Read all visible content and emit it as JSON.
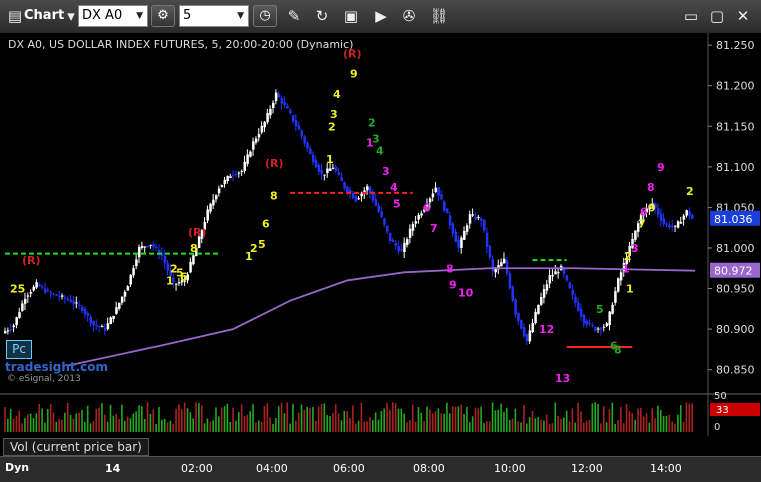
{
  "toolbar": {
    "app_label": "Chart",
    "symbol": "DX A0",
    "interval": "5",
    "icons": [
      "chart-icon",
      "gear-icon",
      "clock-icon",
      "pencil-icon",
      "refresh-icon",
      "export-icon",
      "play-icon",
      "wrench-icon",
      "link-icon"
    ]
  },
  "chart_data": {
    "type": "candlestick",
    "title": "DX A0, US DOLLAR INDEX FUTURES, 5, 20:00-20:00 (Dynamic)",
    "y_ticks": [
      "81.250",
      "81.200",
      "81.150",
      "81.100",
      "81.050",
      "81.000",
      "80.950",
      "80.900",
      "80.850"
    ],
    "ylim": [
      80.82,
      81.265
    ],
    "x_ticks": [
      "14",
      "02:00",
      "04:00",
      "06:00",
      "08:00",
      "10:00",
      "12:00",
      "14:00"
    ],
    "last_price": "81.036",
    "ma_price": "80.972",
    "price_path": [
      [
        0,
        80.895
      ],
      [
        4,
        80.905
      ],
      [
        8,
        80.94
      ],
      [
        12,
        80.955
      ],
      [
        16,
        80.945
      ],
      [
        20,
        80.94
      ],
      [
        24,
        80.935
      ],
      [
        28,
        80.925
      ],
      [
        32,
        80.905
      ],
      [
        36,
        80.9
      ],
      [
        40,
        80.925
      ],
      [
        44,
        80.955
      ],
      [
        48,
        81.0
      ],
      [
        52,
        81.005
      ],
      [
        56,
        80.99
      ],
      [
        60,
        80.955
      ],
      [
        64,
        80.96
      ],
      [
        68,
        81.0
      ],
      [
        72,
        81.045
      ],
      [
        76,
        81.075
      ],
      [
        80,
        81.09
      ],
      [
        84,
        81.095
      ],
      [
        88,
        81.13
      ],
      [
        92,
        81.155
      ],
      [
        96,
        81.19
      ],
      [
        98,
        81.18
      ],
      [
        100,
        81.17
      ],
      [
        104,
        81.145
      ],
      [
        108,
        81.115
      ],
      [
        112,
        81.09
      ],
      [
        116,
        81.1
      ],
      [
        120,
        81.075
      ],
      [
        124,
        81.06
      ],
      [
        128,
        81.075
      ],
      [
        132,
        81.045
      ],
      [
        136,
        81.01
      ],
      [
        140,
        80.995
      ],
      [
        144,
        81.03
      ],
      [
        148,
        81.05
      ],
      [
        152,
        81.075
      ],
      [
        156,
        81.04
      ],
      [
        160,
        81.0
      ],
      [
        164,
        81.04
      ],
      [
        168,
        81.035
      ],
      [
        172,
        80.97
      ],
      [
        176,
        80.985
      ],
      [
        180,
        80.92
      ],
      [
        184,
        80.885
      ],
      [
        188,
        80.93
      ],
      [
        192,
        80.965
      ],
      [
        196,
        80.975
      ],
      [
        200,
        80.94
      ],
      [
        204,
        80.91
      ],
      [
        208,
        80.9
      ],
      [
        212,
        80.905
      ],
      [
        216,
        80.96
      ],
      [
        220,
        81.0
      ],
      [
        224,
        81.04
      ],
      [
        228,
        81.055
      ],
      [
        232,
        81.03
      ],
      [
        236,
        81.025
      ],
      [
        240,
        81.045
      ],
      [
        242,
        81.036
      ]
    ],
    "moving_average": [
      [
        22,
        80.855
      ],
      [
        55,
        80.88
      ],
      [
        80,
        80.9
      ],
      [
        100,
        80.935
      ],
      [
        120,
        80.96
      ],
      [
        140,
        80.97
      ],
      [
        170,
        80.975
      ],
      [
        200,
        80.975
      ],
      [
        242,
        80.972
      ]
    ],
    "levels": [
      {
        "color": "#22dd22",
        "dash": true,
        "from": 0,
        "to": 75,
        "y": 80.993
      },
      {
        "color": "#ff2222",
        "dash": true,
        "from": 100,
        "to": 143,
        "y": 81.068
      },
      {
        "color": "#22dd22",
        "dash": true,
        "from": 185,
        "to": 197,
        "y": 80.985
      },
      {
        "color": "#ff2222",
        "dash": false,
        "from": 197,
        "to": 220,
        "y": 80.878
      }
    ],
    "annotations": [
      {
        "t": "(R)",
        "x": 22,
        "y": 80.98,
        "c": "#cc2222"
      },
      {
        "t": "(R)",
        "x": 188,
        "y": 81.015,
        "c": "#cc2222"
      },
      {
        "t": "(R)",
        "x": 265,
        "y": 81.1,
        "c": "#cc2222"
      },
      {
        "t": "(R)",
        "x": 343,
        "y": 81.235,
        "c": "#cc2222"
      },
      {
        "t": "1",
        "x": 366,
        "y": 81.125,
        "c": "#ee22ee"
      },
      {
        "t": "3",
        "x": 382,
        "y": 81.09,
        "c": "#ee22ee"
      },
      {
        "t": "4",
        "x": 390,
        "y": 81.07,
        "c": "#ee22ee"
      },
      {
        "t": "5",
        "x": 393,
        "y": 81.05,
        "c": "#ee22ee"
      },
      {
        "t": "6",
        "x": 423,
        "y": 81.045,
        "c": "#ee22ee"
      },
      {
        "t": "7",
        "x": 430,
        "y": 81.02,
        "c": "#ee22ee"
      },
      {
        "t": "8",
        "x": 446,
        "y": 80.97,
        "c": "#ee22ee"
      },
      {
        "t": "9",
        "x": 449,
        "y": 80.95,
        "c": "#ee22ee"
      },
      {
        "t": "10",
        "x": 458,
        "y": 80.94,
        "c": "#ee22ee"
      },
      {
        "t": "12",
        "x": 539,
        "y": 80.895,
        "c": "#ee22ee"
      },
      {
        "t": "13",
        "x": 555,
        "y": 80.835,
        "c": "#ee22ee"
      },
      {
        "t": "1",
        "x": 622,
        "y": 80.97,
        "c": "#ee22ee"
      },
      {
        "t": "3",
        "x": 631,
        "y": 80.995,
        "c": "#ee22ee"
      },
      {
        "t": "6",
        "x": 640,
        "y": 81.04,
        "c": "#ee22ee"
      },
      {
        "t": "8",
        "x": 647,
        "y": 81.07,
        "c": "#ee22ee"
      },
      {
        "t": "9",
        "x": 657,
        "y": 81.095,
        "c": "#ee22ee"
      },
      {
        "t": "2",
        "x": 686,
        "y": 81.065,
        "c": "#eeee22"
      },
      {
        "t": "9",
        "x": 648,
        "y": 81.045,
        "c": "#eeee22"
      },
      {
        "t": "25",
        "x": 10,
        "y": 80.945,
        "c": "#eeee22"
      },
      {
        "t": "8",
        "x": 270,
        "y": 81.06,
        "c": "#eeee22"
      },
      {
        "t": "6",
        "x": 262,
        "y": 81.025,
        "c": "#eeee22"
      },
      {
        "t": "5",
        "x": 258,
        "y": 81.0,
        "c": "#eeee22"
      },
      {
        "t": "4",
        "x": 333,
        "y": 81.185,
        "c": "#eeee22"
      },
      {
        "t": "3",
        "x": 330,
        "y": 81.16,
        "c": "#eeee22"
      },
      {
        "t": "2",
        "x": 328,
        "y": 81.145,
        "c": "#eeee22"
      },
      {
        "t": "1",
        "x": 326,
        "y": 81.105,
        "c": "#eeee22"
      },
      {
        "t": "9",
        "x": 350,
        "y": 81.21,
        "c": "#eeee22"
      },
      {
        "t": "8",
        "x": 190,
        "y": 80.995,
        "c": "#eeee22"
      },
      {
        "t": "1",
        "x": 166,
        "y": 80.955,
        "c": "#eeee22"
      },
      {
        "t": "2",
        "x": 170,
        "y": 80.97,
        "c": "#eeee22"
      },
      {
        "t": "5",
        "x": 176,
        "y": 80.965,
        "c": "#eeee22"
      },
      {
        "t": "6",
        "x": 180,
        "y": 80.96,
        "c": "#eeee22"
      },
      {
        "t": "1",
        "x": 245,
        "y": 80.985,
        "c": "#eeee22"
      },
      {
        "t": "2",
        "x": 250,
        "y": 80.995,
        "c": "#eeee22"
      },
      {
        "t": "2",
        "x": 624,
        "y": 80.985,
        "c": "#eeee22"
      },
      {
        "t": "1",
        "x": 626,
        "y": 80.945,
        "c": "#eeee22"
      },
      {
        "t": "7",
        "x": 638,
        "y": 81.025,
        "c": "#eeee22"
      },
      {
        "t": "3",
        "x": 372,
        "y": 81.13,
        "c": "#22aa22"
      },
      {
        "t": "2",
        "x": 368,
        "y": 81.15,
        "c": "#22aa22"
      },
      {
        "t": "4",
        "x": 376,
        "y": 81.115,
        "c": "#22aa22"
      },
      {
        "t": "5",
        "x": 596,
        "y": 80.92,
        "c": "#22aa22"
      },
      {
        "t": "6",
        "x": 610,
        "y": 80.875,
        "c": "#22aa22"
      },
      {
        "t": "8",
        "x": 614,
        "y": 80.87,
        "c": "#22aa22"
      }
    ],
    "volume_ticks": [
      "50",
      "0"
    ],
    "volume_value": "33"
  },
  "watermark": {
    "site": "tradesight.com",
    "copyright": "© eSignal, 2013"
  },
  "badge": "Pc",
  "volume_label": "Vol (current price bar)",
  "footer": {
    "dyn_label": "Dyn"
  },
  "colors": {
    "up": "#ffffff",
    "down": "#2233ff",
    "ma": "#9966cc",
    "last": "#1a3fd8",
    "ma_label": "#9966cc",
    "vol_up": "#22aa22",
    "vol_down": "#aa2222",
    "vol_badge": "#cc0000"
  }
}
